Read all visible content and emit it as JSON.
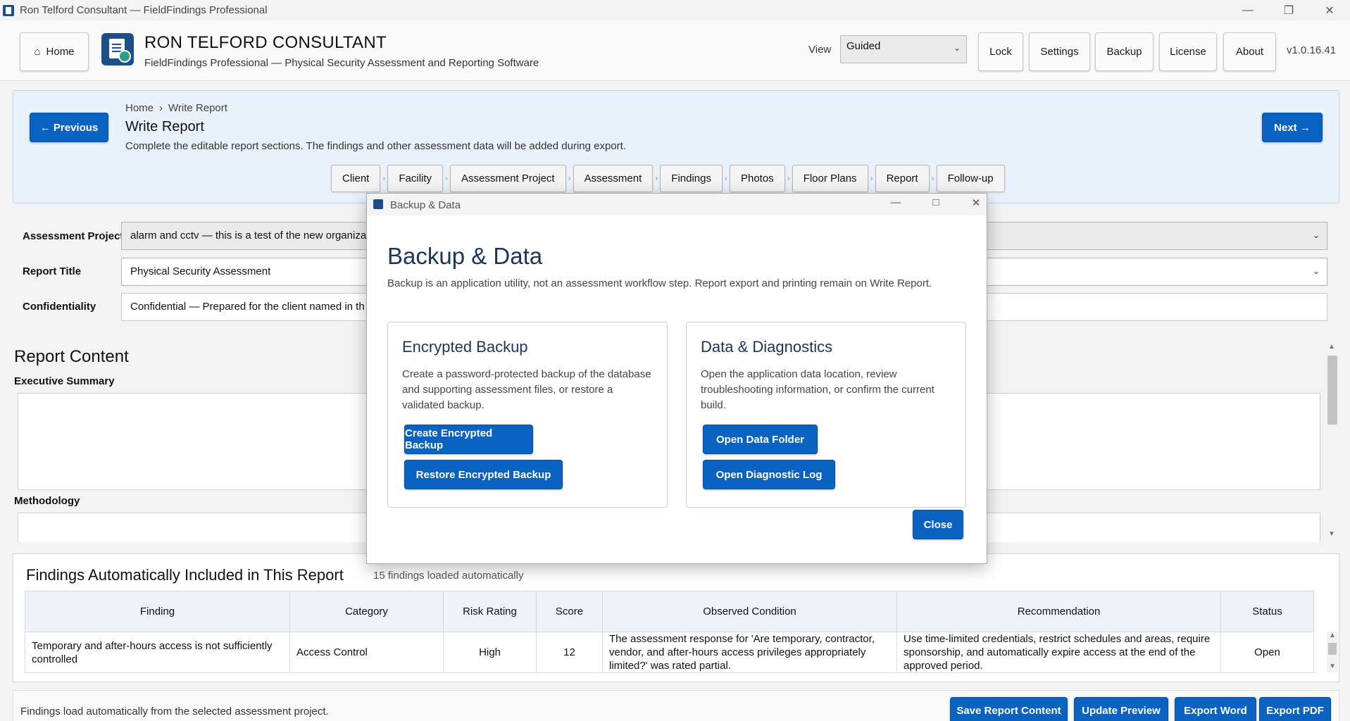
{
  "window": {
    "title": "Ron Telford Consultant — FieldFindings Professional"
  },
  "header": {
    "home_label": "Home",
    "company": "RON TELFORD CONSULTANT",
    "subtitle": "FieldFindings Professional — Physical Security Assessment and Reporting Software",
    "view_label": "View",
    "view_value": "Guided",
    "buttons": {
      "lock": "Lock",
      "settings": "Settings",
      "backup": "Backup",
      "license": "License",
      "about": "About"
    },
    "version": "v1.0.16.41"
  },
  "workflow": {
    "prev_label": "← Previous",
    "next_label": "Next →",
    "breadcrumb": [
      "Home",
      "›",
      "Write Report"
    ],
    "title": "Write Report",
    "description": "Complete the editable report sections. The findings and other assessment data will be added during export.",
    "steps": [
      "Client",
      "Facility",
      "Assessment Project",
      "Assessment",
      "Findings",
      "Photos",
      "Floor Plans",
      "Report",
      "Follow-up"
    ]
  },
  "form": {
    "project_label": "Assessment Project",
    "project_value": "alarm and cctv — this is a test of the new organizat",
    "title_label": "Report Title",
    "title_value": "Physical Security Assessment",
    "conf_label": "Confidentiality",
    "conf_value": "Confidential — Prepared for the client named in th"
  },
  "report_content": {
    "heading": "Report Content",
    "exec_label": "Executive Summary",
    "method_label": "Methodology"
  },
  "findings": {
    "heading": "Findings Automatically Included in This Report",
    "count": "15 findings loaded automatically",
    "columns": [
      "Finding",
      "Category",
      "Risk Rating",
      "Score",
      "Observed Condition",
      "Recommendation",
      "Status"
    ],
    "rows": [
      {
        "finding": "Temporary and after-hours access is not sufficiently controlled",
        "category": "Access Control",
        "risk": "High",
        "score": "12",
        "observed": "The assessment response for 'Are temporary, contractor, vendor, and after-hours access privileges appropriately limited?' was rated partial.",
        "recommendation": "Use time-limited credentials, restrict schedules and areas, require sponsorship, and automatically expire access at the end of the approved period.",
        "status": "Open"
      }
    ]
  },
  "footer": {
    "status": "Findings load automatically from the selected assessment project.",
    "save": "Save Report Content",
    "preview": "Update Preview",
    "word": "Export Word",
    "pdf": "Export PDF"
  },
  "modal": {
    "window_title": "Backup & Data",
    "heading": "Backup & Data",
    "description": "Backup is an application utility, not an assessment workflow step. Report export and printing remain on Write Report.",
    "backup_card": {
      "title": "Encrypted Backup",
      "text": "Create a password-protected backup of the database and supporting assessment files, or restore a validated backup.",
      "create": "Create Encrypted Backup",
      "restore": "Restore Encrypted Backup"
    },
    "data_card": {
      "title": "Data & Diagnostics",
      "text": "Open the application data location, review troubleshooting information, or confirm the current build.",
      "open_folder": "Open Data Folder",
      "open_log": "Open Diagnostic Log"
    },
    "close": "Close"
  },
  "colors": {
    "accent": "#0a62c1",
    "heading": "#1d3557",
    "workflow_bg": "#e9f1fb"
  },
  "icons": [
    "app-icon",
    "home-icon",
    "logo-icon",
    "chevron-down-icon",
    "minimize-icon",
    "maximize-icon",
    "close-icon"
  ]
}
